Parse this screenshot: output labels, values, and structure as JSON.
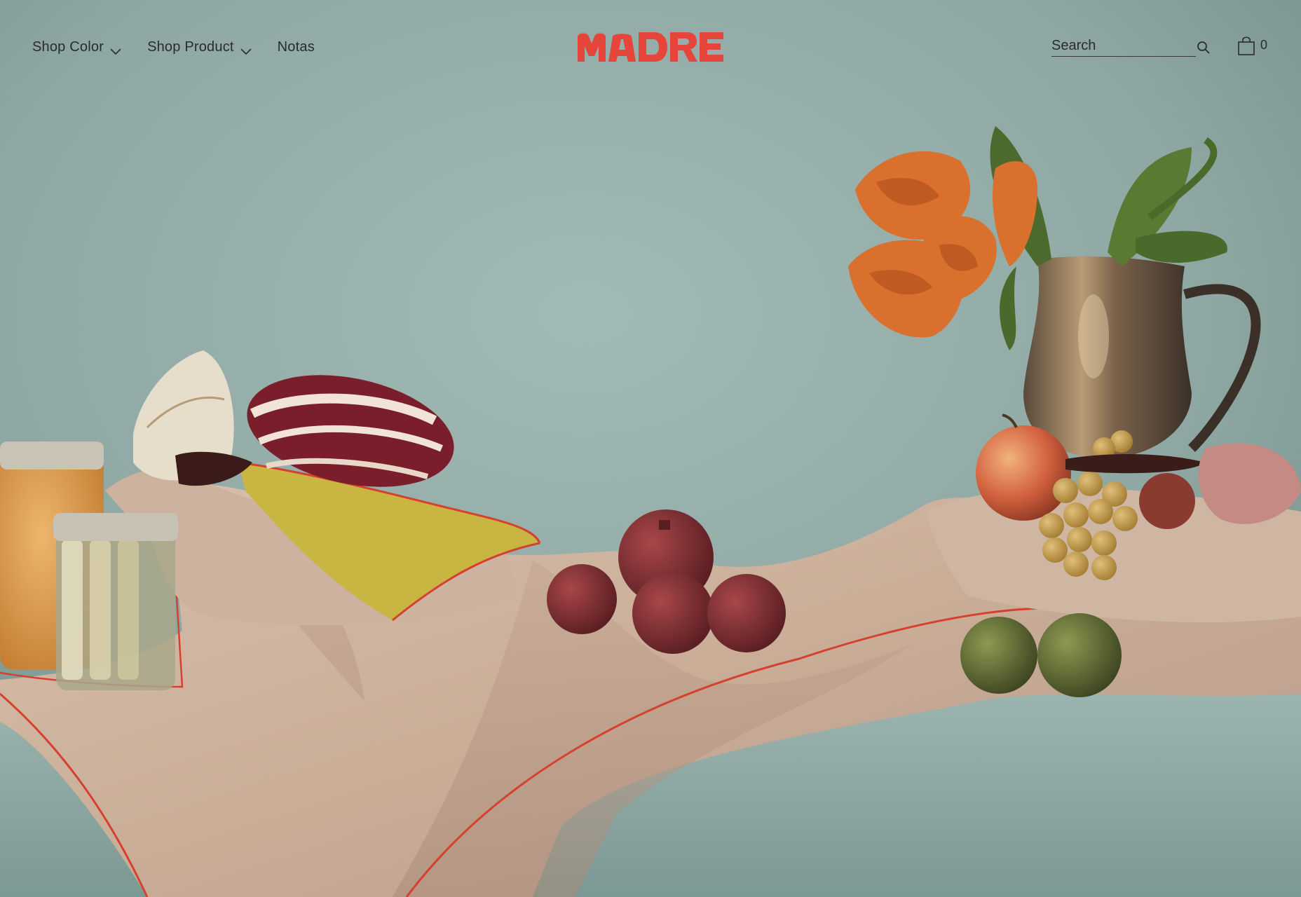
{
  "nav": {
    "items": [
      {
        "label": "Shop Color",
        "has_dropdown": true,
        "icon": "chevron-down-icon"
      },
      {
        "label": "Shop Product",
        "has_dropdown": true,
        "icon": "chevron-down-icon"
      },
      {
        "label": "Notas",
        "has_dropdown": false
      }
    ]
  },
  "logo": {
    "text": "MADRE",
    "color": "#e5453a"
  },
  "search": {
    "placeholder": "Search",
    "value": "",
    "icon": "search-icon"
  },
  "cart": {
    "icon": "shopping-bag-icon",
    "count": "0"
  },
  "colors": {
    "wall": "#8fa9a4",
    "linen": "#cdb29e",
    "piping": "#d6402e",
    "text": "#2b2b2b"
  }
}
